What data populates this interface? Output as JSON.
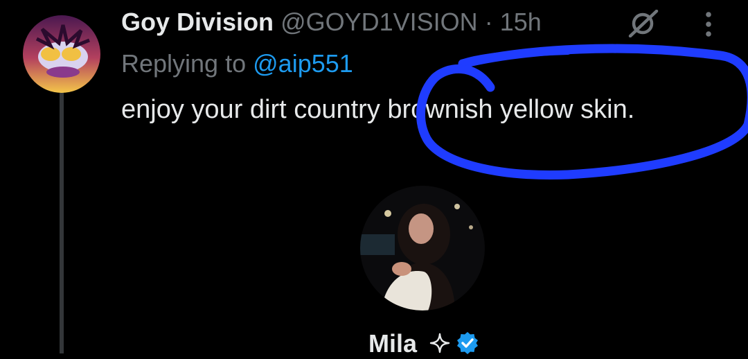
{
  "tweet": {
    "display_name": "Goy Division",
    "handle": "@GOYD1VISION",
    "separator": "·",
    "time": "15h",
    "reply_prefix": "Replying to",
    "reply_handle": "@aip551",
    "text": "enjoy your dirt country brownish yellow skin.",
    "icons": {
      "avatar": "profile-avatar",
      "grok": "grok-icon",
      "more": "more-options-icon"
    }
  },
  "embedded_card": {
    "name": "Mila",
    "icons": {
      "avatar": "profile-photo",
      "sparkle": "sparkle-icon",
      "verified": "verified-badge-icon"
    }
  },
  "annotation": {
    "type": "hand-drawn circle",
    "color": "#1f3cff"
  },
  "colors": {
    "background": "#000000",
    "primary_text": "#e7e9ea",
    "secondary_text": "#71767b",
    "link": "#1d9bf0",
    "verified": "#1d9bf0"
  }
}
